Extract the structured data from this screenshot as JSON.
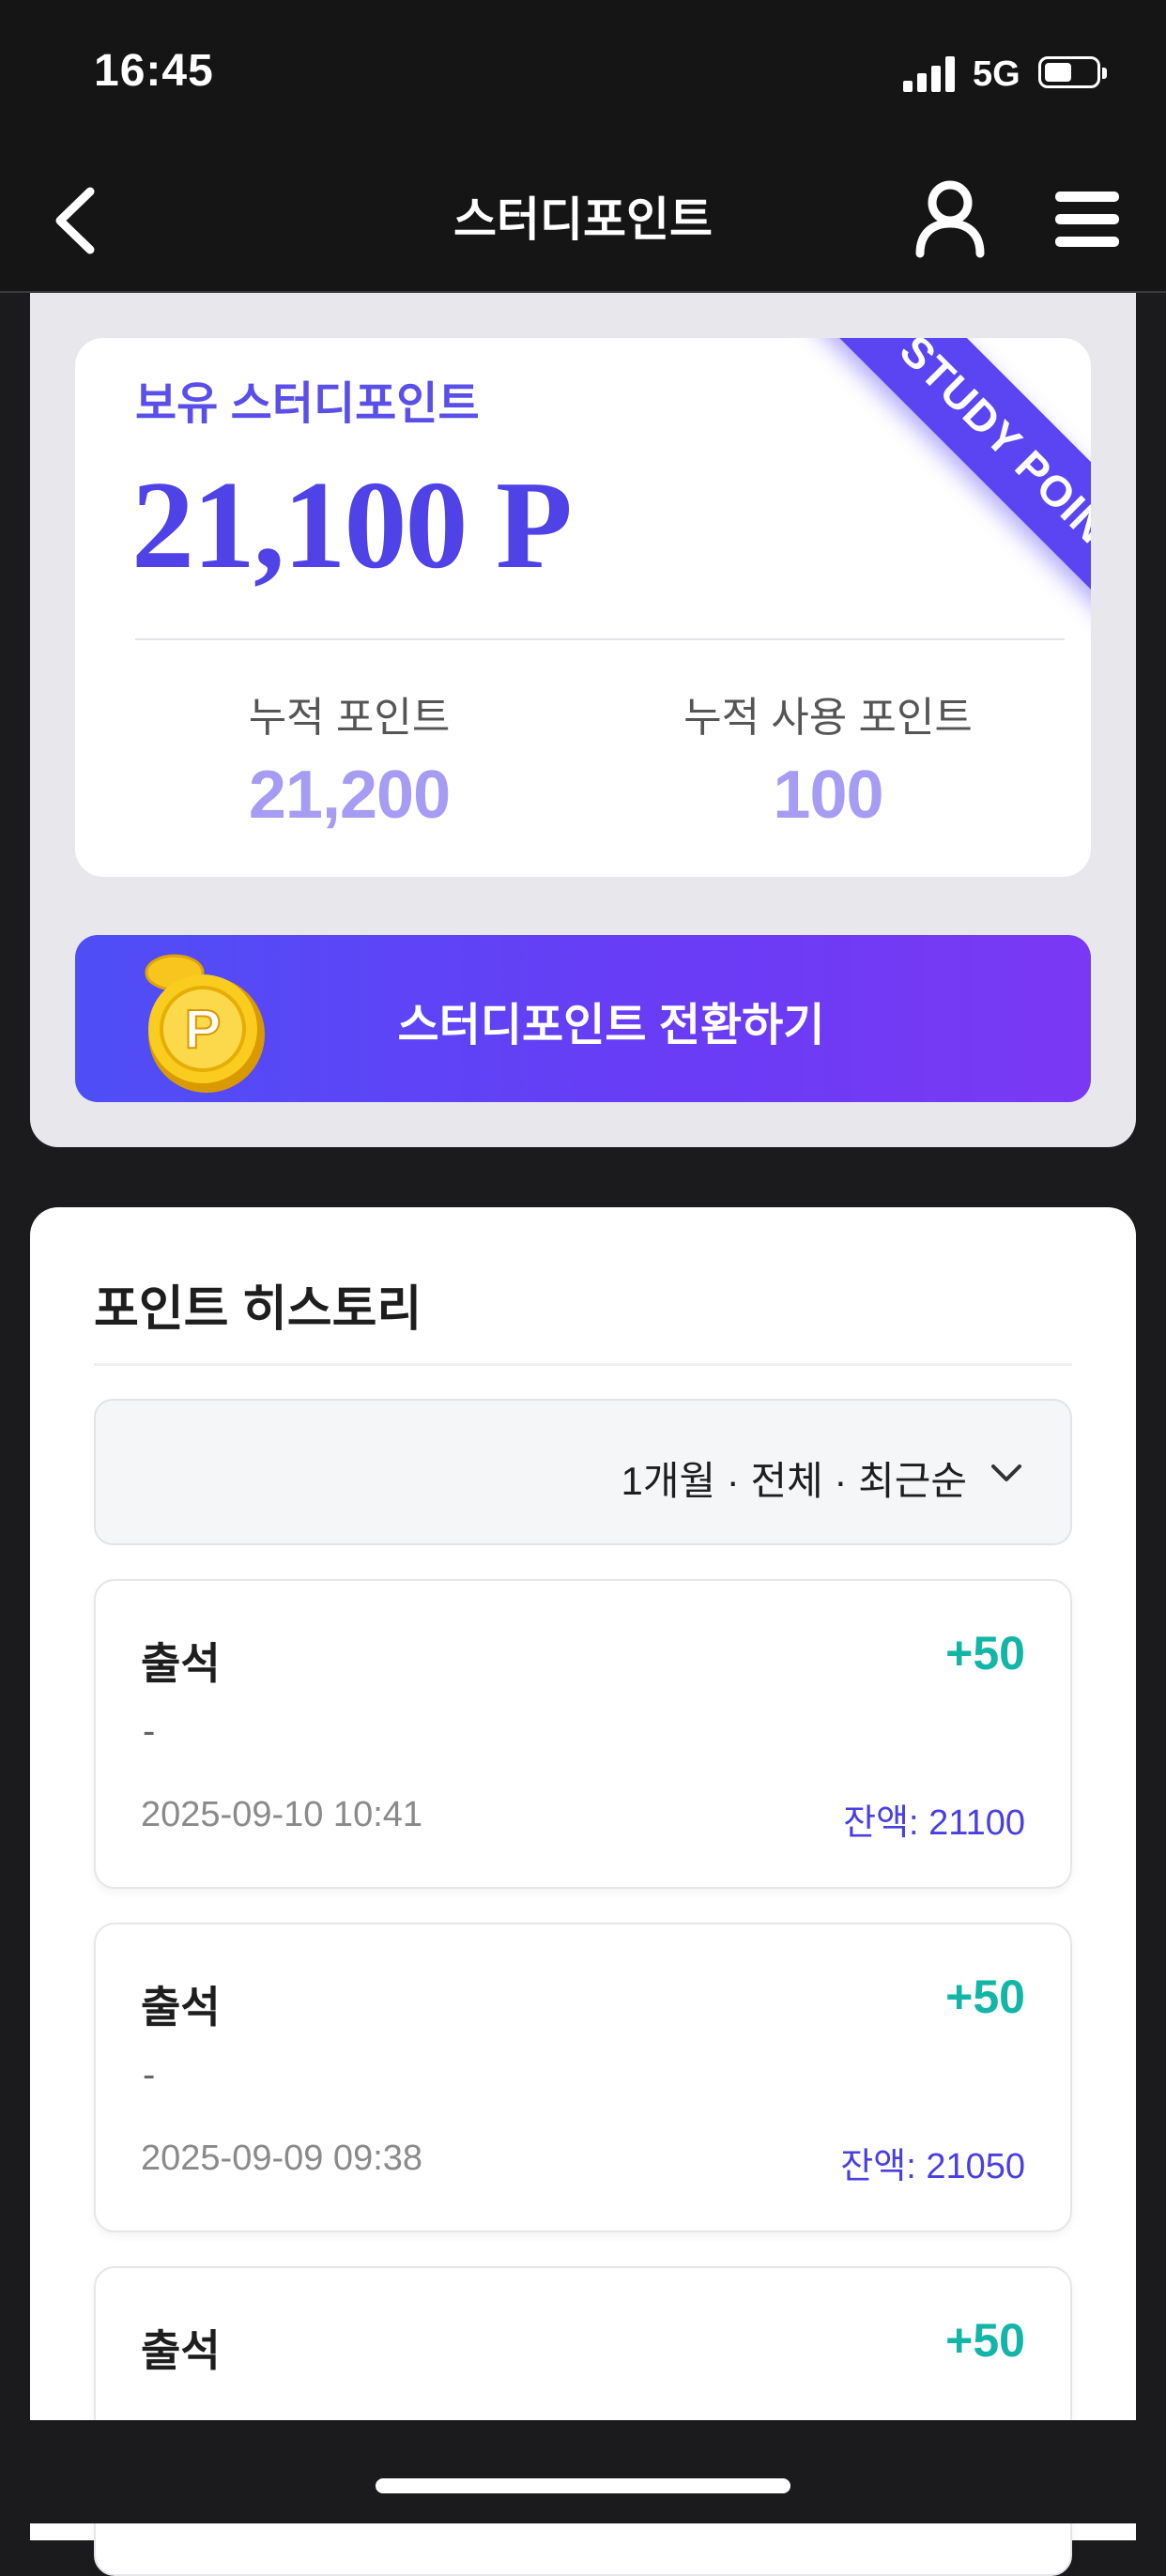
{
  "status_bar": {
    "time": "16:45",
    "network": "5G"
  },
  "header": {
    "title": "스터디포인트"
  },
  "summary": {
    "held_label": "보유 스터디포인트",
    "held_value": "21,100 P",
    "ribbon_text": "STUDY POINT",
    "accumulated_label": "누적 포인트",
    "accumulated_value": "21,200",
    "used_label": "누적 사용 포인트",
    "used_value": "100",
    "convert_button_label": "스터디포인트 전환하기"
  },
  "history": {
    "title": "포인트 히스토리",
    "filter_label": "1개월 · 전체 · 최근순",
    "items": [
      {
        "type": "출석",
        "amount": "+50",
        "memo": "-",
        "date": "2025-09-10 10:41",
        "balance": "잔액: 21100"
      },
      {
        "type": "출석",
        "amount": "+50",
        "memo": "-",
        "date": "2025-09-09 09:38",
        "balance": "잔액: 21050"
      },
      {
        "type": "출석",
        "amount": "+50"
      }
    ]
  },
  "colors": {
    "accent": "#4f42e6",
    "positive": "#13b5a6",
    "background": "#1b1b1d"
  }
}
